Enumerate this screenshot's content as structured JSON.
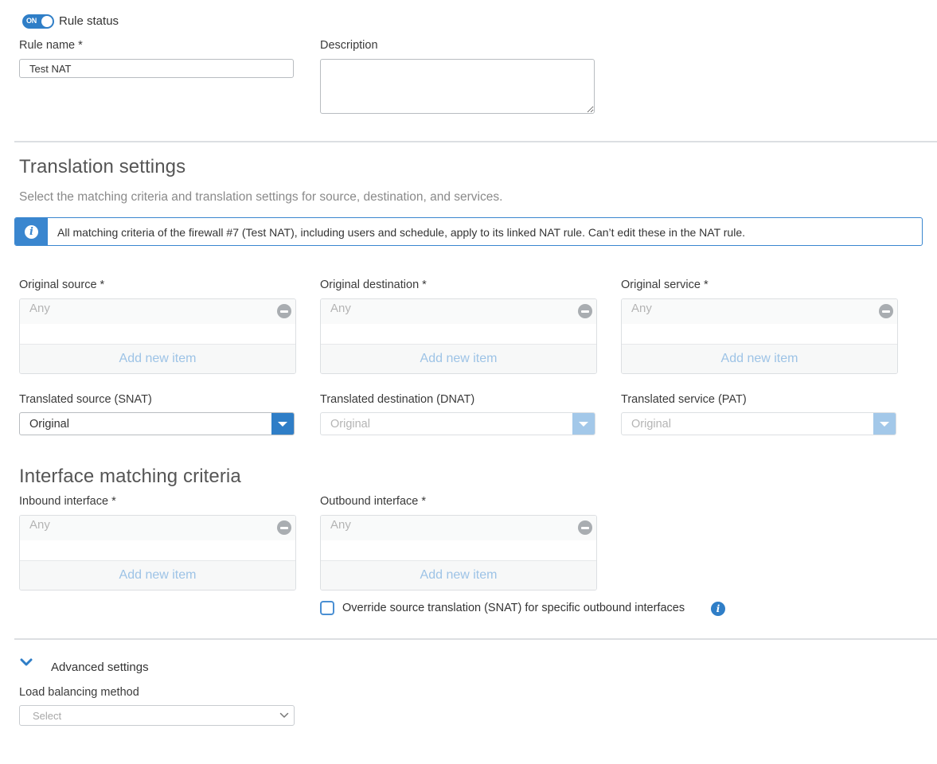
{
  "rule_status": {
    "toggle_text": "ON",
    "label": "Rule status",
    "enabled": true
  },
  "rule_name": {
    "label": "Rule name *",
    "value": "Test NAT"
  },
  "description": {
    "label": "Description",
    "value": ""
  },
  "translation_settings": {
    "title": "Translation settings",
    "subtitle": "Select the matching criteria and translation settings for source, destination, and services.",
    "info_icon": "info-icon",
    "info_text": "All matching criteria of the firewall #7 (Test NAT), including users and schedule, apply to its linked NAT rule. Can’t edit these in the NAT rule.",
    "original_fields": [
      {
        "label": "Original source *",
        "value": "Any",
        "add_label": "Add new item"
      },
      {
        "label": "Original destination *",
        "value": "Any",
        "add_label": "Add new item"
      },
      {
        "label": "Original service *",
        "value": "Any",
        "add_label": "Add new item"
      }
    ],
    "translated_fields": [
      {
        "label": "Translated source (SNAT)",
        "value": "Original",
        "enabled": true
      },
      {
        "label": "Translated destination (DNAT)",
        "value": "Original",
        "enabled": false
      },
      {
        "label": "Translated service (PAT)",
        "value": "Original",
        "enabled": false
      }
    ]
  },
  "interface_matching": {
    "title": "Interface matching criteria",
    "fields": [
      {
        "label": "Inbound interface *",
        "value": "Any",
        "add_label": "Add new item"
      },
      {
        "label": "Outbound interface *",
        "value": "Any",
        "add_label": "Add new item"
      }
    ],
    "override_checkbox": {
      "label": "Override source translation (SNAT) for specific outbound interfaces",
      "checked": false
    }
  },
  "advanced_settings": {
    "label": "Advanced settings",
    "expanded": true,
    "load_balancing": {
      "label": "Load balancing method",
      "placeholder": "Select"
    }
  },
  "colors": {
    "accent": "#2f7ec7",
    "accent_disabled": "#a3c8e9",
    "add_item_text": "#9dc3e6",
    "placeholder_text": "#b4b4b4"
  }
}
